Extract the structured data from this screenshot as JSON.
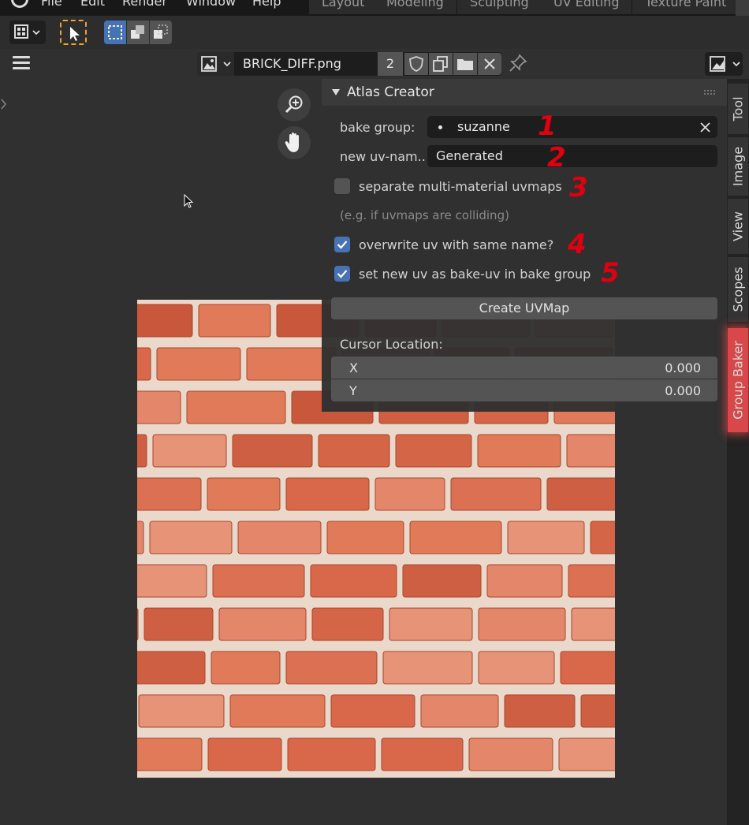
{
  "menubar": {
    "items": [
      "File",
      "Edit",
      "Render",
      "Window",
      "Help"
    ],
    "workspaces": [
      "Layout",
      "Modeling",
      "Sculpting",
      "UV Editing",
      "Texture Paint"
    ]
  },
  "image_header": {
    "filename": "BRICK_DIFF.png",
    "users": "2"
  },
  "panel": {
    "title": "Atlas Creator",
    "bake_group_label": "bake group:",
    "bake_group_value": "suzanne",
    "new_uv_label": "new uv-nam..",
    "new_uv_value": "Generated",
    "separate_label": "separate multi-material uvmaps",
    "separate_checked": false,
    "hint": "(e.g. if uvmaps are colliding)",
    "overwrite_label": "overwrite uv with same name?",
    "overwrite_checked": true,
    "set_bake_label": "set new uv as bake-uv in bake group",
    "set_bake_checked": true,
    "create_button": "Create UVMap",
    "cursor_label": "Cursor Location:",
    "x_label": "X",
    "x_value": "0.000",
    "y_label": "Y",
    "y_value": "0.000"
  },
  "sidebar_tabs": [
    "Tool",
    "Image",
    "View",
    "Scopes",
    "Group Baker"
  ],
  "annotations": [
    "1",
    "2",
    "3",
    "4",
    "5"
  ],
  "colors": {
    "accent_blue": "#4772b3",
    "active_tab": "#d8484a",
    "annotation_red": "#e00010",
    "select_dashed": "#e8a43a"
  }
}
